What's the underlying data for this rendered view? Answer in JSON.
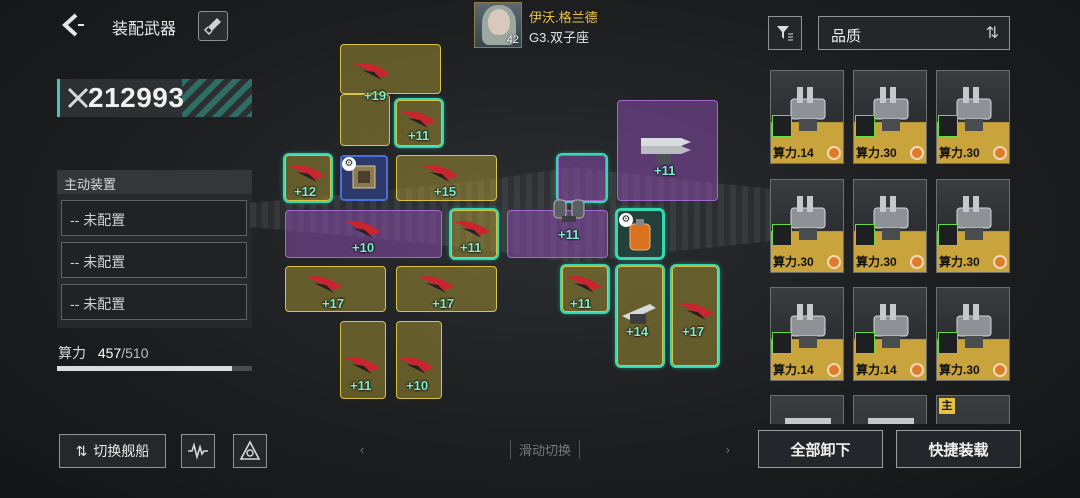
{
  "header": {
    "title": "装配武器",
    "pilot": {
      "name": "伊沃.格兰德",
      "subtitle": "G3.双子座",
      "level": "42"
    }
  },
  "left_panel": {
    "combat_power": "212993",
    "active_section_label": "主动装置",
    "active_slots": [
      {
        "label": "-- 未配置"
      },
      {
        "label": "-- 未配置"
      },
      {
        "label": "-- 未配置"
      }
    ],
    "capacity": {
      "label": "算力",
      "used": "457",
      "total": "/510",
      "fill_fraction": 0.896
    },
    "switch_ship_label": "切换舰船"
  },
  "grid": {
    "nav_hint": "滑动切换",
    "nav_prev": "‹",
    "nav_next": "›",
    "level_tags": [
      "+19",
      "+11",
      "+12",
      "+15",
      "+10",
      "+11",
      "+11",
      "+11",
      "+17",
      "+17",
      "+11",
      "+14",
      "+17",
      "+11",
      "+10"
    ]
  },
  "right_panel": {
    "sort_label": "品质",
    "items": [
      {
        "cost": "算力.14"
      },
      {
        "cost": "算力.30"
      },
      {
        "cost": "算力.30"
      },
      {
        "cost": "算力.30"
      },
      {
        "cost": "算力.30"
      },
      {
        "cost": "算力.30"
      },
      {
        "cost": "算力.14"
      },
      {
        "cost": "算力.14"
      },
      {
        "cost": "算力.30"
      }
    ],
    "main_tag": "主",
    "unequip_all_label": "全部卸下",
    "quick_equip_label": "快捷装载"
  },
  "colors": {
    "accent_teal": "#33d9b0",
    "slot_yellow": "#d8c24a",
    "slot_purple": "#a467d0",
    "pilot_name": "#e9c44a",
    "card_gold": "#c9a33c"
  }
}
